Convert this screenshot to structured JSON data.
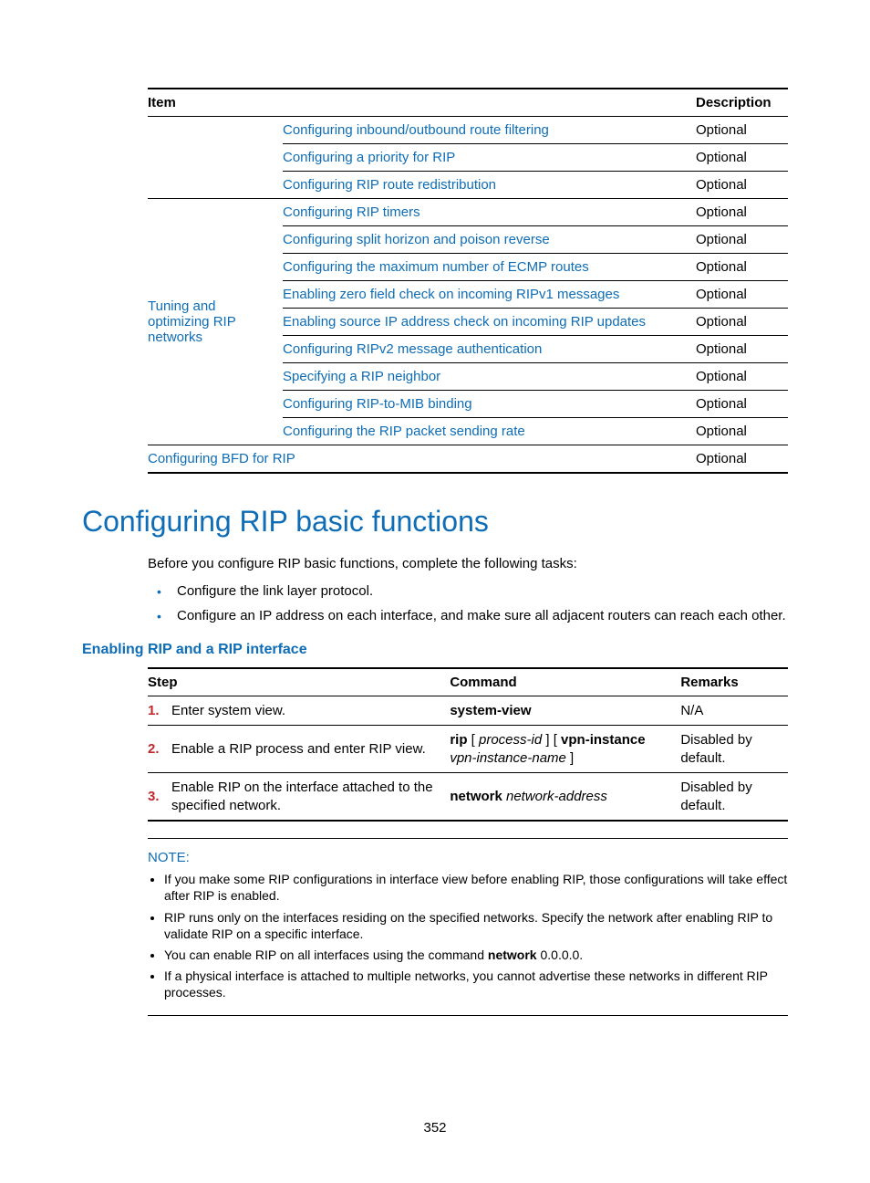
{
  "table1": {
    "headers": {
      "item": "Item",
      "desc": "Description"
    },
    "group1_rows": [
      {
        "link": "Configuring inbound/outbound route filtering",
        "desc": "Optional"
      },
      {
        "link": "Configuring a priority for RIP",
        "desc": "Optional"
      },
      {
        "link": "Configuring RIP route redistribution",
        "desc": "Optional"
      }
    ],
    "group2_label": "Tuning and optimizing RIP networks",
    "group2_rows": [
      {
        "link": "Configuring RIP timers",
        "desc": "Optional"
      },
      {
        "link": "Configuring split horizon and poison reverse",
        "desc": "Optional"
      },
      {
        "link": "Configuring the maximum number of ECMP routes",
        "desc": "Optional"
      },
      {
        "link": "Enabling zero field check on incoming RIPv1 messages",
        "desc": "Optional"
      },
      {
        "link": "Enabling source IP address check on incoming RIP updates",
        "desc": "Optional"
      },
      {
        "link": "Configuring RIPv2 message authentication",
        "desc": "Optional"
      },
      {
        "link": "Specifying a RIP neighbor",
        "desc": "Optional"
      },
      {
        "link": "Configuring RIP-to-MIB binding",
        "desc": "Optional"
      },
      {
        "link": "Configuring the RIP packet sending rate",
        "desc": "Optional"
      }
    ],
    "last_row": {
      "link": "Configuring BFD for RIP",
      "desc": "Optional"
    }
  },
  "heading": "Configuring RIP basic functions",
  "intro": "Before you configure RIP basic functions, complete the following tasks:",
  "bullets": [
    "Configure the link layer protocol.",
    "Configure an IP address on each interface, and make sure all adjacent routers can reach each other."
  ],
  "subheading": "Enabling RIP and a RIP interface",
  "table2": {
    "headers": {
      "step": "Step",
      "cmd": "Command",
      "remarks": "Remarks"
    },
    "rows": [
      {
        "num": "1.",
        "step": "Enter system view.",
        "cmd_bold1": "system-view",
        "remarks": "N/A"
      },
      {
        "num": "2.",
        "step": "Enable a RIP process and enter RIP view.",
        "cmd_bold1": "rip",
        "cmd_plain1": " [ ",
        "cmd_ital1": "process-id",
        "cmd_plain2": " ] [ ",
        "cmd_bold2": "vpn-instance",
        "cmd_ital2": "vpn-instance-name",
        "cmd_plain3": " ]",
        "remarks": "Disabled by default."
      },
      {
        "num": "3.",
        "step": "Enable RIP on the interface attached to the specified network.",
        "cmd_bold1": "network",
        "cmd_ital1": "network-address",
        "remarks": "Disabled by default."
      }
    ]
  },
  "note": {
    "title": "NOTE:",
    "items": [
      {
        "pre": "If you make some RIP configurations in interface view before enabling RIP, those configurations will take effect after RIP is enabled."
      },
      {
        "pre": "RIP runs only on the interfaces residing on the specified networks. Specify the network after enabling RIP to validate RIP on a specific interface."
      },
      {
        "pre": "You can enable RIP on all interfaces using the command ",
        "bold": "network",
        "post": " 0.0.0.0."
      },
      {
        "pre": "If a physical interface is attached to multiple networks, you cannot advertise these networks in different RIP processes."
      }
    ]
  },
  "page_number": "352"
}
